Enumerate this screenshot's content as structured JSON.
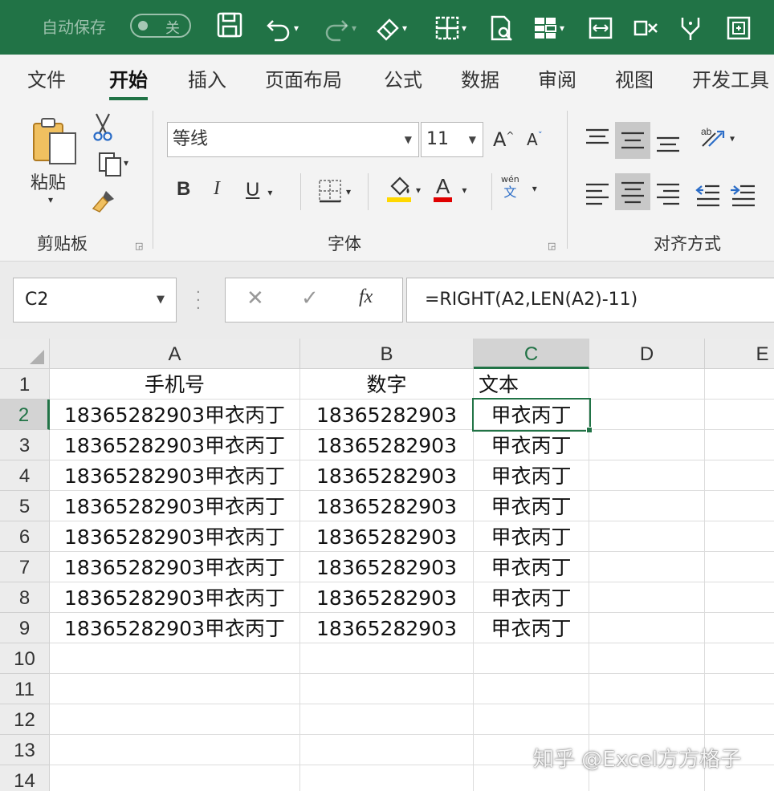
{
  "titlebar": {
    "autosave_label": "自动保存",
    "autosave_state": "关"
  },
  "ribbon_tabs": [
    "文件",
    "开始",
    "插入",
    "页面布局",
    "公式",
    "数据",
    "审阅",
    "视图",
    "开发工具"
  ],
  "active_tab": "开始",
  "clipboard": {
    "paste_label": "粘贴",
    "group_label": "剪贴板"
  },
  "font": {
    "name": "等线",
    "size": "11",
    "bold": "B",
    "italic": "I",
    "underline": "U",
    "font_color_glyph": "A",
    "phonetic_top": "wén",
    "phonetic_bottom": "文",
    "group_label": "字体"
  },
  "alignment": {
    "group_label": "对齐方式"
  },
  "formula_bar": {
    "name_box": "C2",
    "formula": "=RIGHT(A2,LEN(A2)-11)",
    "fx": "fx"
  },
  "sheet": {
    "columns": [
      "A",
      "B",
      "C",
      "D",
      "E"
    ],
    "selected_column": "C",
    "rows": [
      "1",
      "2",
      "3",
      "4",
      "5",
      "6",
      "7",
      "8",
      "9",
      "10",
      "11",
      "12",
      "13",
      "14"
    ],
    "selected_row": "2",
    "headers": [
      "手机号",
      "数字",
      "文本"
    ],
    "data": [
      [
        "18365282903甲衣丙丁",
        "18365282903",
        "甲衣丙丁"
      ],
      [
        "18365282903甲衣丙丁",
        "18365282903",
        "甲衣丙丁"
      ],
      [
        "18365282903甲衣丙丁",
        "18365282903",
        "甲衣丙丁"
      ],
      [
        "18365282903甲衣丙丁",
        "18365282903",
        "甲衣丙丁"
      ],
      [
        "18365282903甲衣丙丁",
        "18365282903",
        "甲衣丙丁"
      ],
      [
        "18365282903甲衣丙丁",
        "18365282903",
        "甲衣丙丁"
      ],
      [
        "18365282903甲衣丙丁",
        "18365282903",
        "甲衣丙丁"
      ],
      [
        "18365282903甲衣丙丁",
        "18365282903",
        "甲衣丙丁"
      ]
    ]
  },
  "watermark": "知乎 @Excel方方格子",
  "colors": {
    "accent": "#217346",
    "highlight_yellow": "#ffd800",
    "font_red": "#e00000"
  }
}
